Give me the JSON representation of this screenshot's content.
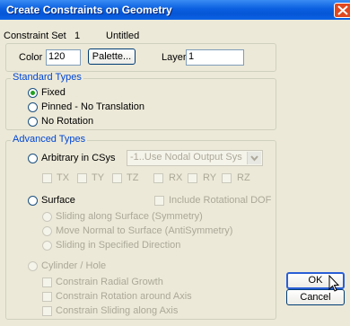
{
  "window": {
    "title": "Create Constraints on Geometry"
  },
  "header": {
    "constraint_set_label": "Constraint Set",
    "constraint_set_number": "1",
    "constraint_set_name": "Untitled"
  },
  "color": {
    "label": "Color",
    "value": "120",
    "palette_label": "Palette..."
  },
  "layer": {
    "label": "Layer",
    "value": "1"
  },
  "standard": {
    "legend": "Standard Types",
    "fixed": "Fixed",
    "pinned": "Pinned - No Translation",
    "no_rotation": "No Rotation",
    "selected": "Fixed"
  },
  "advanced": {
    "legend": "Advanced Types",
    "arbitrary": "Arbitrary in CSys",
    "csys_value": "-1..Use Nodal Output Sys",
    "tx": "TX",
    "ty": "TY",
    "tz": "TZ",
    "rx": "RX",
    "ry": "RY",
    "rz": "RZ",
    "surface": "Surface",
    "include_rot": "Include Rotational DOF",
    "sliding_surface": "Sliding along Surface (Symmetry)",
    "move_normal": "Move Normal to Surface (AntiSymmetry)",
    "sliding_direction": "Sliding in Specified Direction",
    "cylinder": "Cylinder / Hole",
    "radial": "Constrain Radial Growth",
    "rotation_axis": "Constrain Rotation around Axis",
    "sliding_axis": "Constrain Sliding along Axis"
  },
  "buttons": {
    "ok": "OK",
    "cancel": "Cancel"
  },
  "icons": {
    "close": "close-icon",
    "cursor": "mouse-cursor-icon"
  }
}
